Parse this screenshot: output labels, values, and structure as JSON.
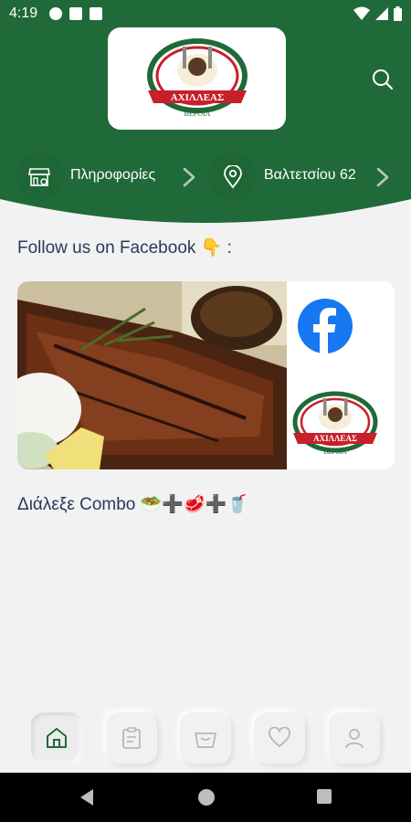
{
  "status_bar": {
    "time": "4:19"
  },
  "header": {
    "logo": {
      "brand_name": "ΑΧΙΛΛΕΑΣ",
      "city": "ΒΕΡΟΙΑ"
    },
    "info_label": "Πληροφορίες",
    "address_label": "Βαλτετσίου 62"
  },
  "main": {
    "facebook_title": "Follow us on Facebook 👇 :",
    "combo_title": "Διάλεξε Combo 🥗➕🥩➕🥤"
  },
  "colors": {
    "primary_green": "#1f6a38",
    "dark_green": "#1e6636",
    "title_text": "#273a57",
    "facebook_blue": "#1877f2"
  },
  "bottom_nav": {
    "items": [
      {
        "icon": "home-icon",
        "active": true
      },
      {
        "icon": "clipboard-icon",
        "active": false
      },
      {
        "icon": "basket-icon",
        "active": false
      },
      {
        "icon": "heart-icon",
        "active": false
      },
      {
        "icon": "user-icon",
        "active": false
      }
    ]
  }
}
